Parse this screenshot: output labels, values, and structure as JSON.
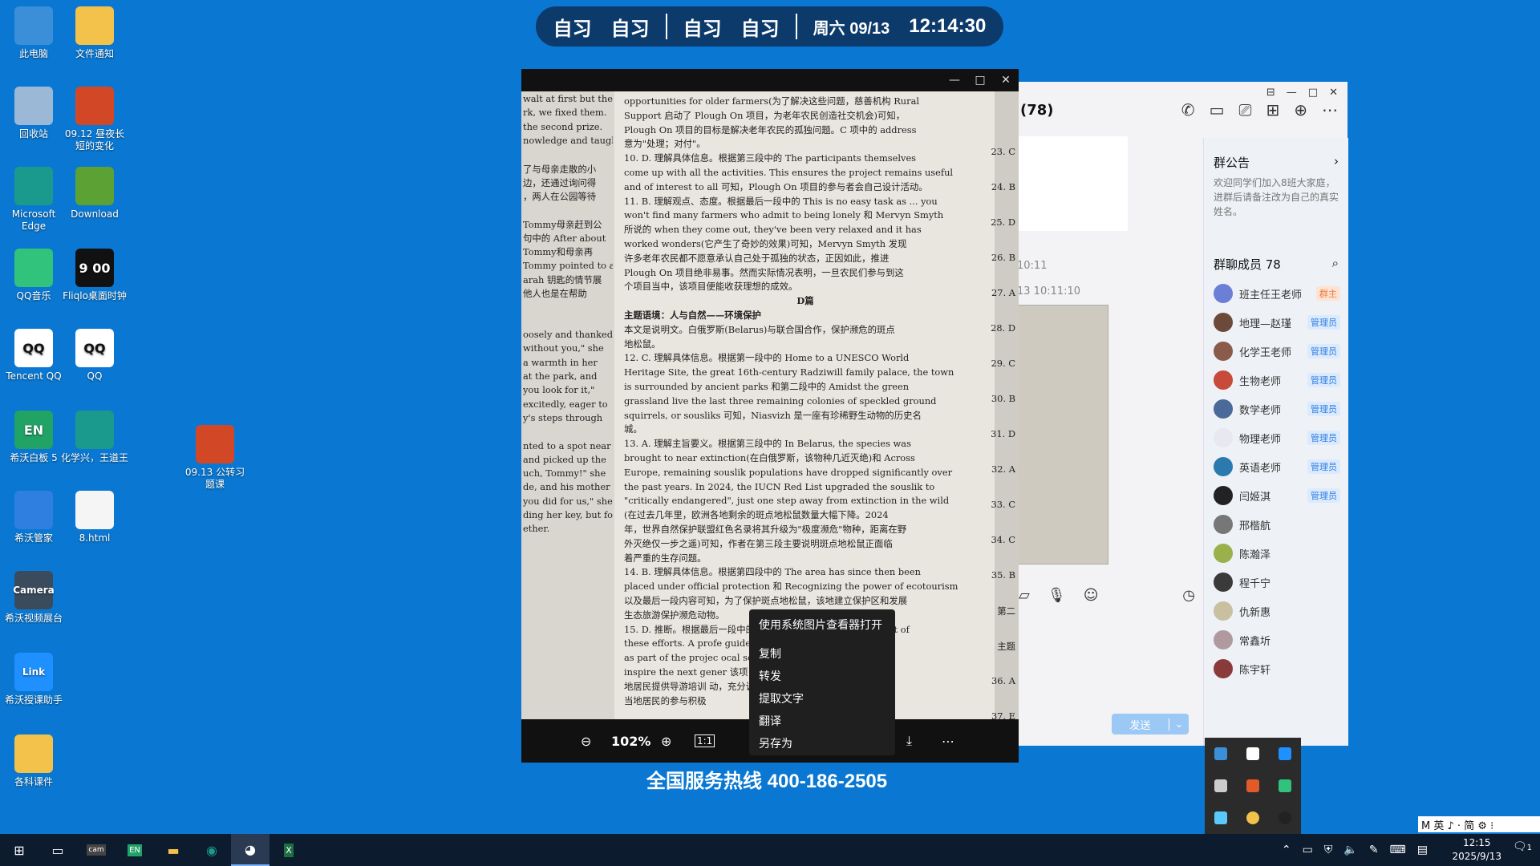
{
  "desktop_icons": [
    {
      "label": "此电脑",
      "color": "#3b8fd8"
    },
    {
      "label": "文件通知",
      "color": "#f2c24a"
    },
    {
      "label": "回收站",
      "color": "#9bb9d6"
    },
    {
      "label": "09.12 昼夜长短的变化",
      "color": "#d24726"
    },
    {
      "label": "Microsoft Edge",
      "color": "#1a9a8c"
    },
    {
      "label": "Download",
      "color": "#5ca134"
    },
    {
      "label": "QQ音乐",
      "color": "#31c27c"
    },
    {
      "label": "Fliqlo桌面时钟",
      "color": "#111111",
      "glyph": "9 00"
    },
    {
      "label": "Tencent QQ",
      "color": "#ffffff",
      "glyph": "QQ"
    },
    {
      "label": "QQ",
      "color": "#ffffff",
      "glyph": "QQ"
    },
    {
      "label": "希沃白板 5",
      "color": "#21a366",
      "glyph": "EN"
    },
    {
      "label": "化学兴，王道王",
      "color": "#1a9a8c"
    },
    {
      "label": "09.13 公转习题课",
      "color": "#d24726"
    },
    {
      "label": "希沃管家",
      "color": "#2f7fe0"
    },
    {
      "label": "8.html",
      "color": "#f5f5f5"
    },
    {
      "label": "希沃视频展台",
      "color": "#3a4b5c",
      "glyph": "Camera"
    },
    {
      "label": "希沃授课助手",
      "color": "#1e90ff",
      "glyph": "Link"
    },
    {
      "label": "各科课件",
      "color": "#f2c24a"
    }
  ],
  "schedule": {
    "items": [
      "自习",
      "自习",
      "自习",
      "自习"
    ],
    "date": "周六 09/13",
    "time": "12:14:30"
  },
  "viewer": {
    "window_controls": [
      "—",
      "□",
      "✕"
    ],
    "zoom": "102%",
    "left_column": [
      "walt at first but then",
      "rk, we fixed them.",
      "the second prize.",
      "nowledge and taught",
      "",
      "了与母亲走散的小",
      "边，还通过询问得",
      "，两人在公园等待",
      "",
      "Tommy母亲赶到公",
      "句中的 After about",
      "Tommy和母亲再",
      "Tommy pointed to a",
      "arah 钥匙的情节展",
      "他人也是在帮助",
      "",
      "",
      "oosely and thanked",
      "without you,\" she",
      "a warmth in her",
      "at the park, and",
      "you look for it,\"",
      "excitedly, eager to",
      "y's steps through",
      "",
      "nted to a spot near",
      "and picked up the",
      "uch, Tommy!\" she",
      "de, and his mother",
      "you did for us,\" she",
      "ding her key, but for",
      "ether."
    ],
    "doc_lines": [
      "opportunities for older farmers(为了解决这些问题，慈善机构 Rural",
      "Support 启动了 Plough On 项目，为老年农民创造社交机会)可知，",
      "Plough On 项目的目标是解决老年农民的孤独问题。C 项中的 address",
      "意为\"处理；对付\"。",
      "10. D. 理解具体信息。根据第三段中的 The participants themselves",
      "come up with all the activities. This ensures the project remains useful",
      "and of interest to all 可知，Plough On 项目的参与者会自己设计活动。",
      "11. B. 理解观点、态度。根据最后一段中的 This is no easy task as ... you",
      "won't find many farmers who admit to being lonely 和 Mervyn Smyth",
      "所说的 when they come out, they've been very relaxed and it has",
      "worked wonders(它产生了奇妙的效果)可知，Mervyn Smyth 发现",
      "许多老年农民都不愿意承认自己处于孤独的状态，正因如此，推进",
      "Plough On 项目绝非易事。然而实际情况表明，一旦农民们参与到这",
      "个项目当中，该项目便能收获理想的成效。",
      "D篇",
      "主题语境：人与自然——环境保护",
      "本文是说明文。白俄罗斯(Belarus)与联合国合作，保护濒危的斑点",
      "地松鼠。",
      "12. C. 理解具体信息。根据第一段中的 Home to a UNESCO World",
      "Heritage Site, the great 16th-century Radziwill family palace, the town",
      "is surrounded by ancient parks 和第二段中的 Amidst the green",
      "grassland live the last three remaining colonies of speckled ground",
      "squirrels, or sousliks 可知，Niasvizh 是一座有珍稀野生动物的历史名",
      "城。",
      "13. A. 理解主旨要义。根据第三段中的 In Belarus, the species was",
      "brought to near extinction(在白俄罗斯，该物种几近灭绝)和 Across",
      "Europe, remaining souslik populations have dropped significantly over",
      "the past years. In 2024, the IUCN Red List upgraded the souslik to",
      "\"critically endangered\", just one step away from extinction in the wild",
      "(在过去几年里，欧洲各地剩余的斑点地松鼠数量大幅下降。2024",
      "年，世界自然保护联盟红色名录将其升级为\"极度濒危\"物种，距离在野",
      "外灭绝仅一步之遥)可知，作者在第三段主要说明斑点地松鼠正面临",
      "着严重的生存问题。",
      "14. B. 理解具体信息。根据第四段中的 The area has since then been",
      "placed under official protection 和 Recognizing the power of ecotourism",
      "以及最后一段内容可知，为了保护斑点地松鼠，该地建立保护区和发展",
      "生态旅游保护濒危动物。",
      "15. D. 推断。根据最后一段中的 Local farmers are at the heart of",
      "these efforts. A profe                                    guides, designed",
      "as part of the projec                                    ocal schools will",
      "inspire the next gener                                   该项目不仅为当",
      "地居民提供导游培训                                       动，充分调动了",
      "当地居民的参与积极"
    ],
    "right_numbers": [
      "23. C",
      "24. B",
      "25. D",
      "26. B",
      "27. A",
      "28. D",
      "29. C",
      "30. B",
      "31. D",
      "32. A",
      "33. C",
      "34. C",
      "35. B",
      "第二",
      "主题",
      "36. A",
      "37. E"
    ]
  },
  "context_menu": [
    "使用系统图片查看器打开",
    "复制",
    "转发",
    "提取文字",
    "翻译",
    "另存为"
  ],
  "hotline": "全国服务热线 400-186-2505",
  "chat": {
    "title": "(78)",
    "timestamps": [
      "10:11",
      "13 10:11:10"
    ],
    "send_label": "发送",
    "announcement_title": "群公告",
    "announcement_text": "欢迎同学们加入8班大家庭，进群后请备注改为自己的真实姓名。",
    "members_title": "群聊成员 78",
    "members": [
      {
        "name": "班主任王老师",
        "badge": "群主",
        "owner": true,
        "color": "#6b7fd7"
      },
      {
        "name": "地理—赵瑾",
        "badge": "管理员",
        "color": "#6b4a3a"
      },
      {
        "name": "化学王老师",
        "badge": "管理员",
        "color": "#8a5a4a"
      },
      {
        "name": "生物老师",
        "badge": "管理员",
        "color": "#c74a3a"
      },
      {
        "name": "数学老师",
        "badge": "管理员",
        "color": "#4a6a9a"
      },
      {
        "name": "物理老师",
        "badge": "管理员",
        "color": "#e8e8f0"
      },
      {
        "name": "英语老师",
        "badge": "管理员",
        "color": "#2a7ab0"
      },
      {
        "name": "闫姬淇",
        "badge": "管理员",
        "color": "#222222"
      },
      {
        "name": "邢楷航",
        "badge": "",
        "color": "#777777"
      },
      {
        "name": "陈瀚泽",
        "badge": "",
        "color": "#9ab04a"
      },
      {
        "name": "程千宁",
        "badge": "",
        "color": "#3a3a3a"
      },
      {
        "name": "仇新惠",
        "badge": "",
        "color": "#c8c0a0"
      },
      {
        "name": "常鑫圻",
        "badge": "",
        "color": "#b09aa0"
      },
      {
        "name": "陈宇轩",
        "badge": "",
        "color": "#8a3a3a"
      }
    ]
  },
  "taskbar": {
    "time": "12:15",
    "date": "2025/9/13",
    "ime": "M 英 ♪ · 简 ⚙ ⁝",
    "notification_count": "1"
  }
}
